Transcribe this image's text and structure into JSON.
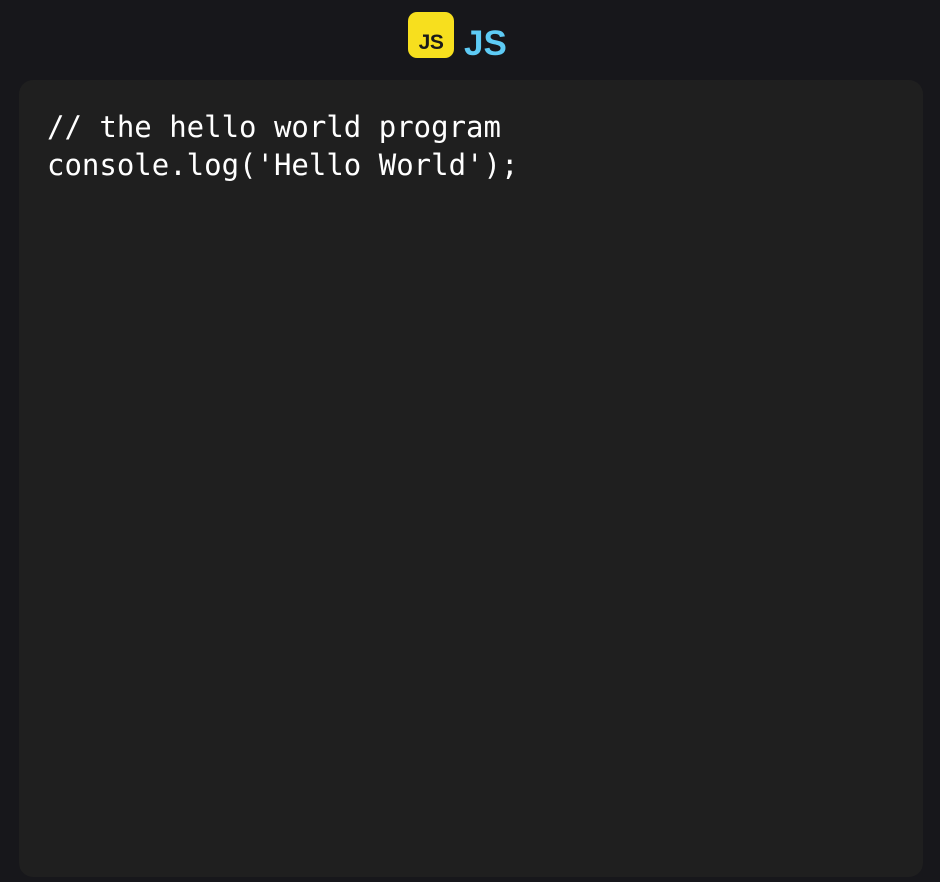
{
  "header": {
    "logo_text": "JS",
    "title": "JS"
  },
  "editor": {
    "lines": [
      "// the hello world program",
      "console.log('Hello World');"
    ]
  },
  "colors": {
    "page_background": "#17171b",
    "editor_background": "#1f1f1f",
    "logo_badge": "#f7df1e",
    "title_accent": "#5ecbf5",
    "code_text": "#ffffff"
  },
  "icons": {
    "logo": "javascript-logo-icon"
  }
}
